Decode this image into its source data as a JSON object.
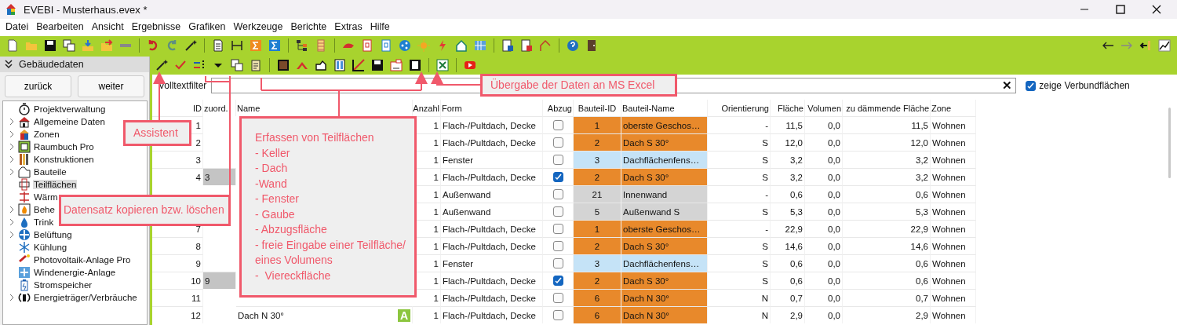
{
  "window": {
    "title": "EVEBI - Musterhaus.evex *"
  },
  "menu": [
    "Datei",
    "Bearbeiten",
    "Ansicht",
    "Ergebnisse",
    "Grafiken",
    "Werkzeuge",
    "Berichte",
    "Extras",
    "Hilfe"
  ],
  "sidebar": {
    "title": "Gebäudedaten",
    "buttons": [
      "zurück",
      "weiter"
    ],
    "items": [
      {
        "label": "Projektverwaltung",
        "expandable": false,
        "selected": false
      },
      {
        "label": "Allgemeine Daten",
        "expandable": true,
        "selected": false
      },
      {
        "label": "Zonen",
        "expandable": true,
        "selected": false
      },
      {
        "label": "Raumbuch Pro",
        "expandable": true,
        "selected": false
      },
      {
        "label": "Konstruktionen",
        "expandable": true,
        "selected": false
      },
      {
        "label": "Bauteile",
        "expandable": true,
        "selected": false
      },
      {
        "label": "Teilflächen",
        "expandable": false,
        "selected": true
      },
      {
        "label": "Wärm",
        "expandable": false,
        "selected": false
      },
      {
        "label": "Behe",
        "expandable": true,
        "selected": false
      },
      {
        "label": "Trink",
        "expandable": true,
        "selected": false
      },
      {
        "label": "Belüftung",
        "expandable": true,
        "selected": false
      },
      {
        "label": "Kühlung",
        "expandable": false,
        "selected": false
      },
      {
        "label": "Photovoltaik-Anlage Pro",
        "expandable": false,
        "selected": false
      },
      {
        "label": "Windenergie-Anlage",
        "expandable": false,
        "selected": false
      },
      {
        "label": "Stromspeicher",
        "expandable": false,
        "selected": false
      },
      {
        "label": "Energieträger/Verbräuche",
        "expandable": true,
        "selected": false
      }
    ]
  },
  "filter": {
    "label": "Volltextfilter",
    "clear": "✕",
    "checkbox": {
      "label": "zeige Verbundflächen",
      "checked": true
    }
  },
  "table": {
    "columns": [
      "ID",
      "zuord.",
      "Name",
      "Anzahl",
      "Form",
      "Abzug",
      "Bauteil-ID",
      "Bauteil-Name",
      "Orientierung",
      "Fläche",
      "Volumen",
      "zu dämmende Fläche",
      "Zone"
    ],
    "rows": [
      {
        "id": "1",
        "anzahl": "1",
        "form": "Flach-/Pultdach, Decke",
        "abzug": false,
        "bauteil_id": "1",
        "bauteil_name": "oberste Geschos…",
        "color": "#e8892b",
        "orientierung": "-",
        "flaeche": "11,5",
        "volumen": "0,0",
        "daemm": "11,5",
        "zone": "Wohnen"
      },
      {
        "id": "2",
        "anzahl": "1",
        "form": "Flach-/Pultdach, Decke",
        "abzug": false,
        "bauteil_id": "2",
        "bauteil_name": "Dach S 30°",
        "color": "#e8892b",
        "orientierung": "S",
        "flaeche": "12,0",
        "volumen": "0,0",
        "daemm": "12,0",
        "zone": "Wohnen"
      },
      {
        "id": "3",
        "anzahl": "1",
        "form": "Fenster",
        "abzug": false,
        "bauteil_id": "3",
        "bauteil_name": "Dachflächenfens…",
        "color": "#c5e3f7",
        "orientierung": "S",
        "flaeche": "3,2",
        "volumen": "0,0",
        "daemm": "3,2",
        "zone": "Wohnen"
      },
      {
        "id": "4",
        "zuord": "3",
        "anzahl": "1",
        "form": "Flach-/Pultdach, Decke",
        "abzug": true,
        "bauteil_id": "2",
        "bauteil_name": "Dach S 30°",
        "color": "#e8892b",
        "orientierung": "S",
        "flaeche": "3,2",
        "volumen": "0,0",
        "daemm": "3,2",
        "zone": "Wohnen"
      },
      {
        "anzahl": "1",
        "form": "Außenwand",
        "abzug": false,
        "bauteil_id": "21",
        "bauteil_name": "Innenwand",
        "color": "#d4d4d4",
        "orientierung": "-",
        "flaeche": "0,6",
        "volumen": "0,0",
        "daemm": "0,6",
        "zone": "Wohnen"
      },
      {
        "anzahl": "1",
        "form": "Außenwand",
        "abzug": false,
        "bauteil_id": "5",
        "bauteil_name": "Außenwand S",
        "color": "#d4d4d4",
        "orientierung": "S",
        "flaeche": "5,3",
        "volumen": "0,0",
        "daemm": "5,3",
        "zone": "Wohnen"
      },
      {
        "id": "7",
        "anzahl": "1",
        "form": "Flach-/Pultdach, Decke",
        "abzug": false,
        "bauteil_id": "1",
        "bauteil_name": "oberste Geschos…",
        "color": "#e8892b",
        "orientierung": "-",
        "flaeche": "22,9",
        "volumen": "0,0",
        "daemm": "22,9",
        "zone": "Wohnen"
      },
      {
        "id": "8",
        "anzahl": "1",
        "form": "Flach-/Pultdach, Decke",
        "abzug": false,
        "bauteil_id": "2",
        "bauteil_name": "Dach S 30°",
        "color": "#e8892b",
        "orientierung": "S",
        "flaeche": "14,6",
        "volumen": "0,0",
        "daemm": "14,6",
        "zone": "Wohnen"
      },
      {
        "id": "9",
        "anzahl": "1",
        "form": "Fenster",
        "abzug": false,
        "bauteil_id": "3",
        "bauteil_name": "Dachflächenfens…",
        "color": "#c5e3f7",
        "orientierung": "S",
        "flaeche": "0,6",
        "volumen": "0,0",
        "daemm": "0,6",
        "zone": "Wohnen"
      },
      {
        "id": "10",
        "zuord": "9",
        "anzahl": "1",
        "form": "Flach-/Pultdach, Decke",
        "abzug": true,
        "bauteil_id": "2",
        "bauteil_name": "Dach S 30°",
        "color": "#e8892b",
        "orientierung": "S",
        "flaeche": "0,6",
        "volumen": "0,0",
        "daemm": "0,6",
        "zone": "Wohnen"
      },
      {
        "id": "11",
        "anzahl": "1",
        "form": "Flach-/Pultdach, Decke",
        "abzug": false,
        "bauteil_id": "6",
        "bauteil_name": "Dach N 30°",
        "color": "#e8892b",
        "orientierung": "N",
        "flaeche": "0,7",
        "volumen": "0,0",
        "daemm": "0,7",
        "zone": "Wohnen"
      },
      {
        "id": "12",
        "name": "Dach N 30°",
        "badge": "A",
        "anzahl": "1",
        "form": "Flach-/Pultdach, Decke",
        "abzug": false,
        "bauteil_id": "6",
        "bauteil_name": "Dach N 30°",
        "color": "#e8892b",
        "orientierung": "N",
        "flaeche": "2,9",
        "volumen": "0,0",
        "daemm": "2,9",
        "zone": "Wohnen"
      }
    ]
  },
  "annotations": [
    {
      "lines": [
        "Assistent"
      ]
    },
    {
      "lines": [
        "Datensatz kopieren bzw. löschen"
      ]
    },
    {
      "lines": [
        "Erfassen von Teilflächen",
        "- Keller",
        "- Dach",
        "-Wand",
        "- Fenster",
        "- Gaube",
        "- Abzugsfläche",
        "- freie Eingabe einer Teilfläche/",
        "eines Volumens",
        "-  Viereckfläche"
      ]
    },
    {
      "lines": [
        "Übergabe der Daten an MS Excel"
      ]
    }
  ]
}
